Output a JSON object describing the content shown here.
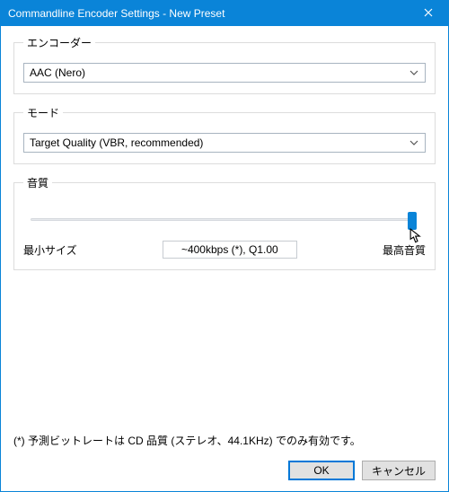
{
  "window": {
    "title": "Commandline Encoder Settings - New Preset"
  },
  "encoder": {
    "legend": "エンコーダー",
    "selected": "AAC (Nero)"
  },
  "mode": {
    "legend": "モード",
    "selected": "Target Quality (VBR, recommended)"
  },
  "quality": {
    "legend": "音質",
    "min_label": "最小サイズ",
    "max_label": "最高音質",
    "bitrate_display": "~400kbps (*), Q1.00",
    "slider_value": 1.0,
    "slider_min": 0.0,
    "slider_max": 1.0
  },
  "footnote": "(*) 予測ビットレートは CD 品質 (ステレオ、44.1KHz) でのみ有効です。",
  "buttons": {
    "ok": "OK",
    "cancel": "キャンセル"
  }
}
